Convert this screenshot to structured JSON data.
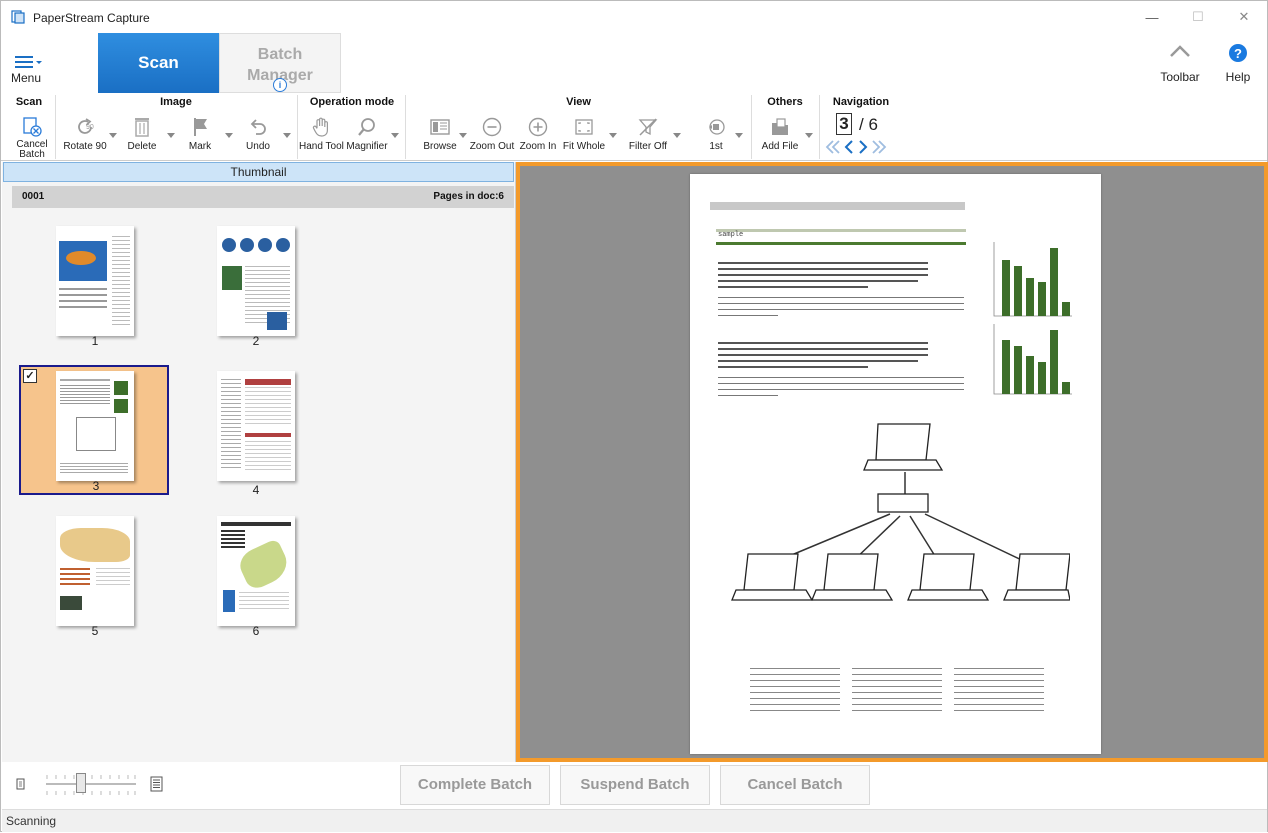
{
  "app": {
    "title": "PaperStream Capture"
  },
  "window_controls": {
    "minimize": "—",
    "maximize": "☐",
    "close": "✕"
  },
  "menu": {
    "label": "Menu"
  },
  "tabs": {
    "scan": "Scan",
    "batch_manager_line1": "Batch",
    "batch_manager_line2": "Manager",
    "info": "i"
  },
  "top_right": {
    "toolbar": "Toolbar",
    "help": "Help"
  },
  "ribbon": {
    "groups": {
      "scan": "Scan",
      "image": "Image",
      "operation_mode": "Operation mode",
      "view": "View",
      "others": "Others",
      "navigation": "Navigation"
    },
    "tools": {
      "cancel_batch_line1": "Cancel",
      "cancel_batch_line2": "Batch",
      "rotate_90": "Rotate 90",
      "delete": "Delete",
      "mark": "Mark",
      "undo": "Undo",
      "hand_tool": "Hand Tool",
      "magnifier": "Magnifier",
      "browse": "Browse",
      "zoom_out": "Zoom Out",
      "zoom_in": "Zoom In",
      "fit_whole": "Fit Whole",
      "filter_off": "Filter Off",
      "first": "1st",
      "add_file": "Add File",
      "rotate_badge": "90"
    },
    "navigation": {
      "current": "3",
      "total": "/ 6"
    }
  },
  "thumbnail_panel": {
    "header": "Thumbnail",
    "doc_id": "0001",
    "pages_in_doc": "Pages in doc:6",
    "pages": [
      {
        "num": "1",
        "selected": false
      },
      {
        "num": "2",
        "selected": false
      },
      {
        "num": "3",
        "selected": true,
        "check": "✓"
      },
      {
        "num": "4",
        "selected": false
      },
      {
        "num": "5",
        "selected": false
      },
      {
        "num": "6",
        "selected": false
      }
    ]
  },
  "preview": {
    "sample_label": "sample",
    "chart_color": "#3d6e2a"
  },
  "bottom_bar": {
    "complete_batch": "Complete Batch",
    "suspend_batch": "Suspend Batch",
    "cancel_batch": "Cancel Batch"
  },
  "status": {
    "text": "Scanning"
  },
  "colors": {
    "accent": "#1a6fc4",
    "viewer_border": "#f39a2b",
    "selected_thumb": "#f6c48c"
  }
}
